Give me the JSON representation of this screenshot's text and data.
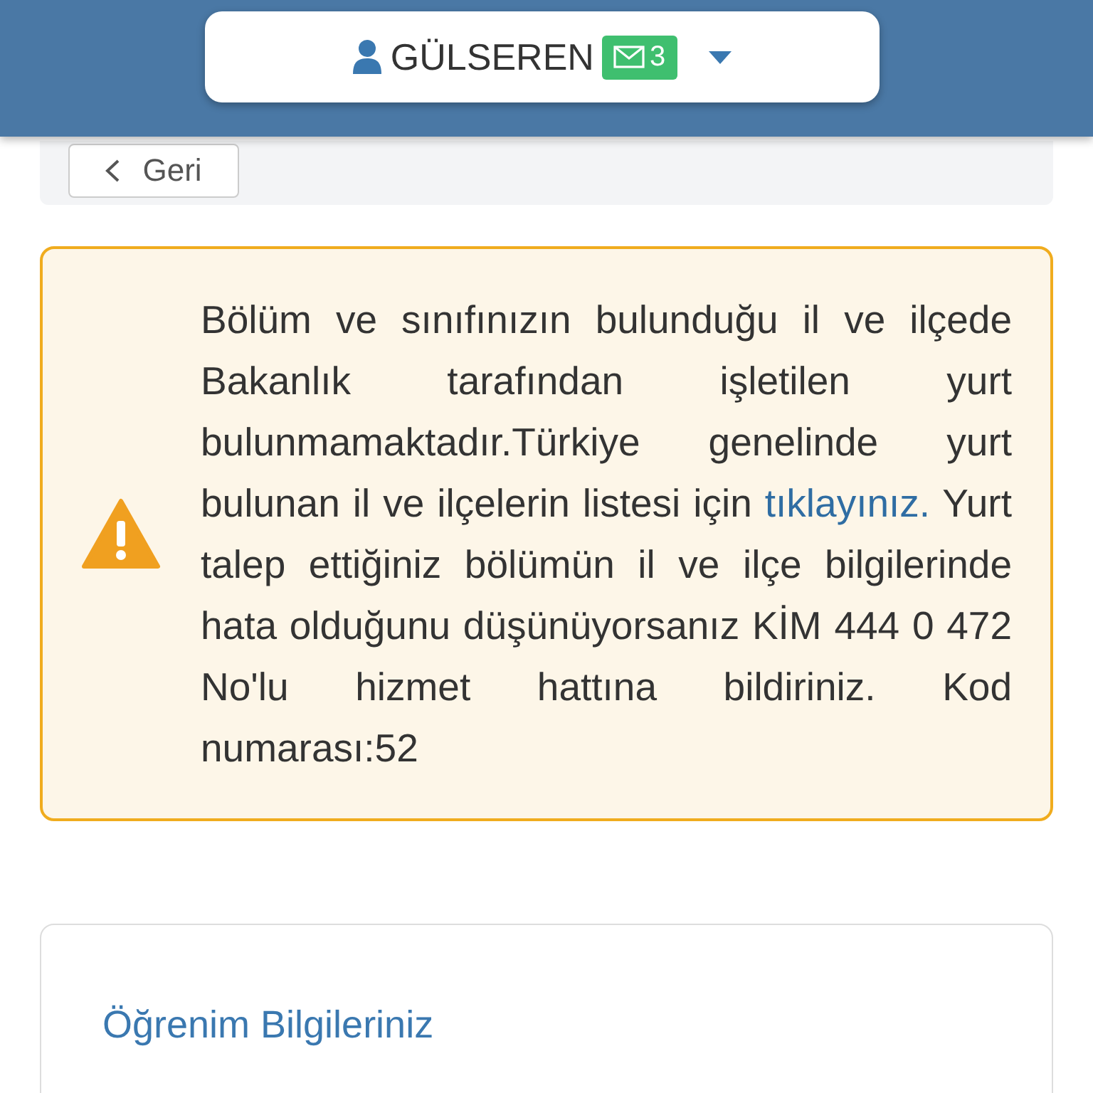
{
  "header": {
    "user_name": "GÜLSEREN",
    "message_count": "3"
  },
  "back_button": {
    "label": "Geri"
  },
  "alert": {
    "text_before": "Bölüm ve sınıfınızın bulunduğu il ve ilçede Bakanlık tarafından işletilen yurt bulunmamaktadır.Türkiye genelinde yurt bulunan il ve ilçelerin listesi için ",
    "link": "tıklayınız.",
    "text_after": " Yurt talep ettiğiniz bölümün il ve ilçe bilgilerinde hata olduğunu düşünüyorsanız KİM 444 0 472 No'lu hizmet hattına bildiriniz. Kod numarası:52"
  },
  "section": {
    "title": "Öğrenim Bilgileriniz"
  }
}
